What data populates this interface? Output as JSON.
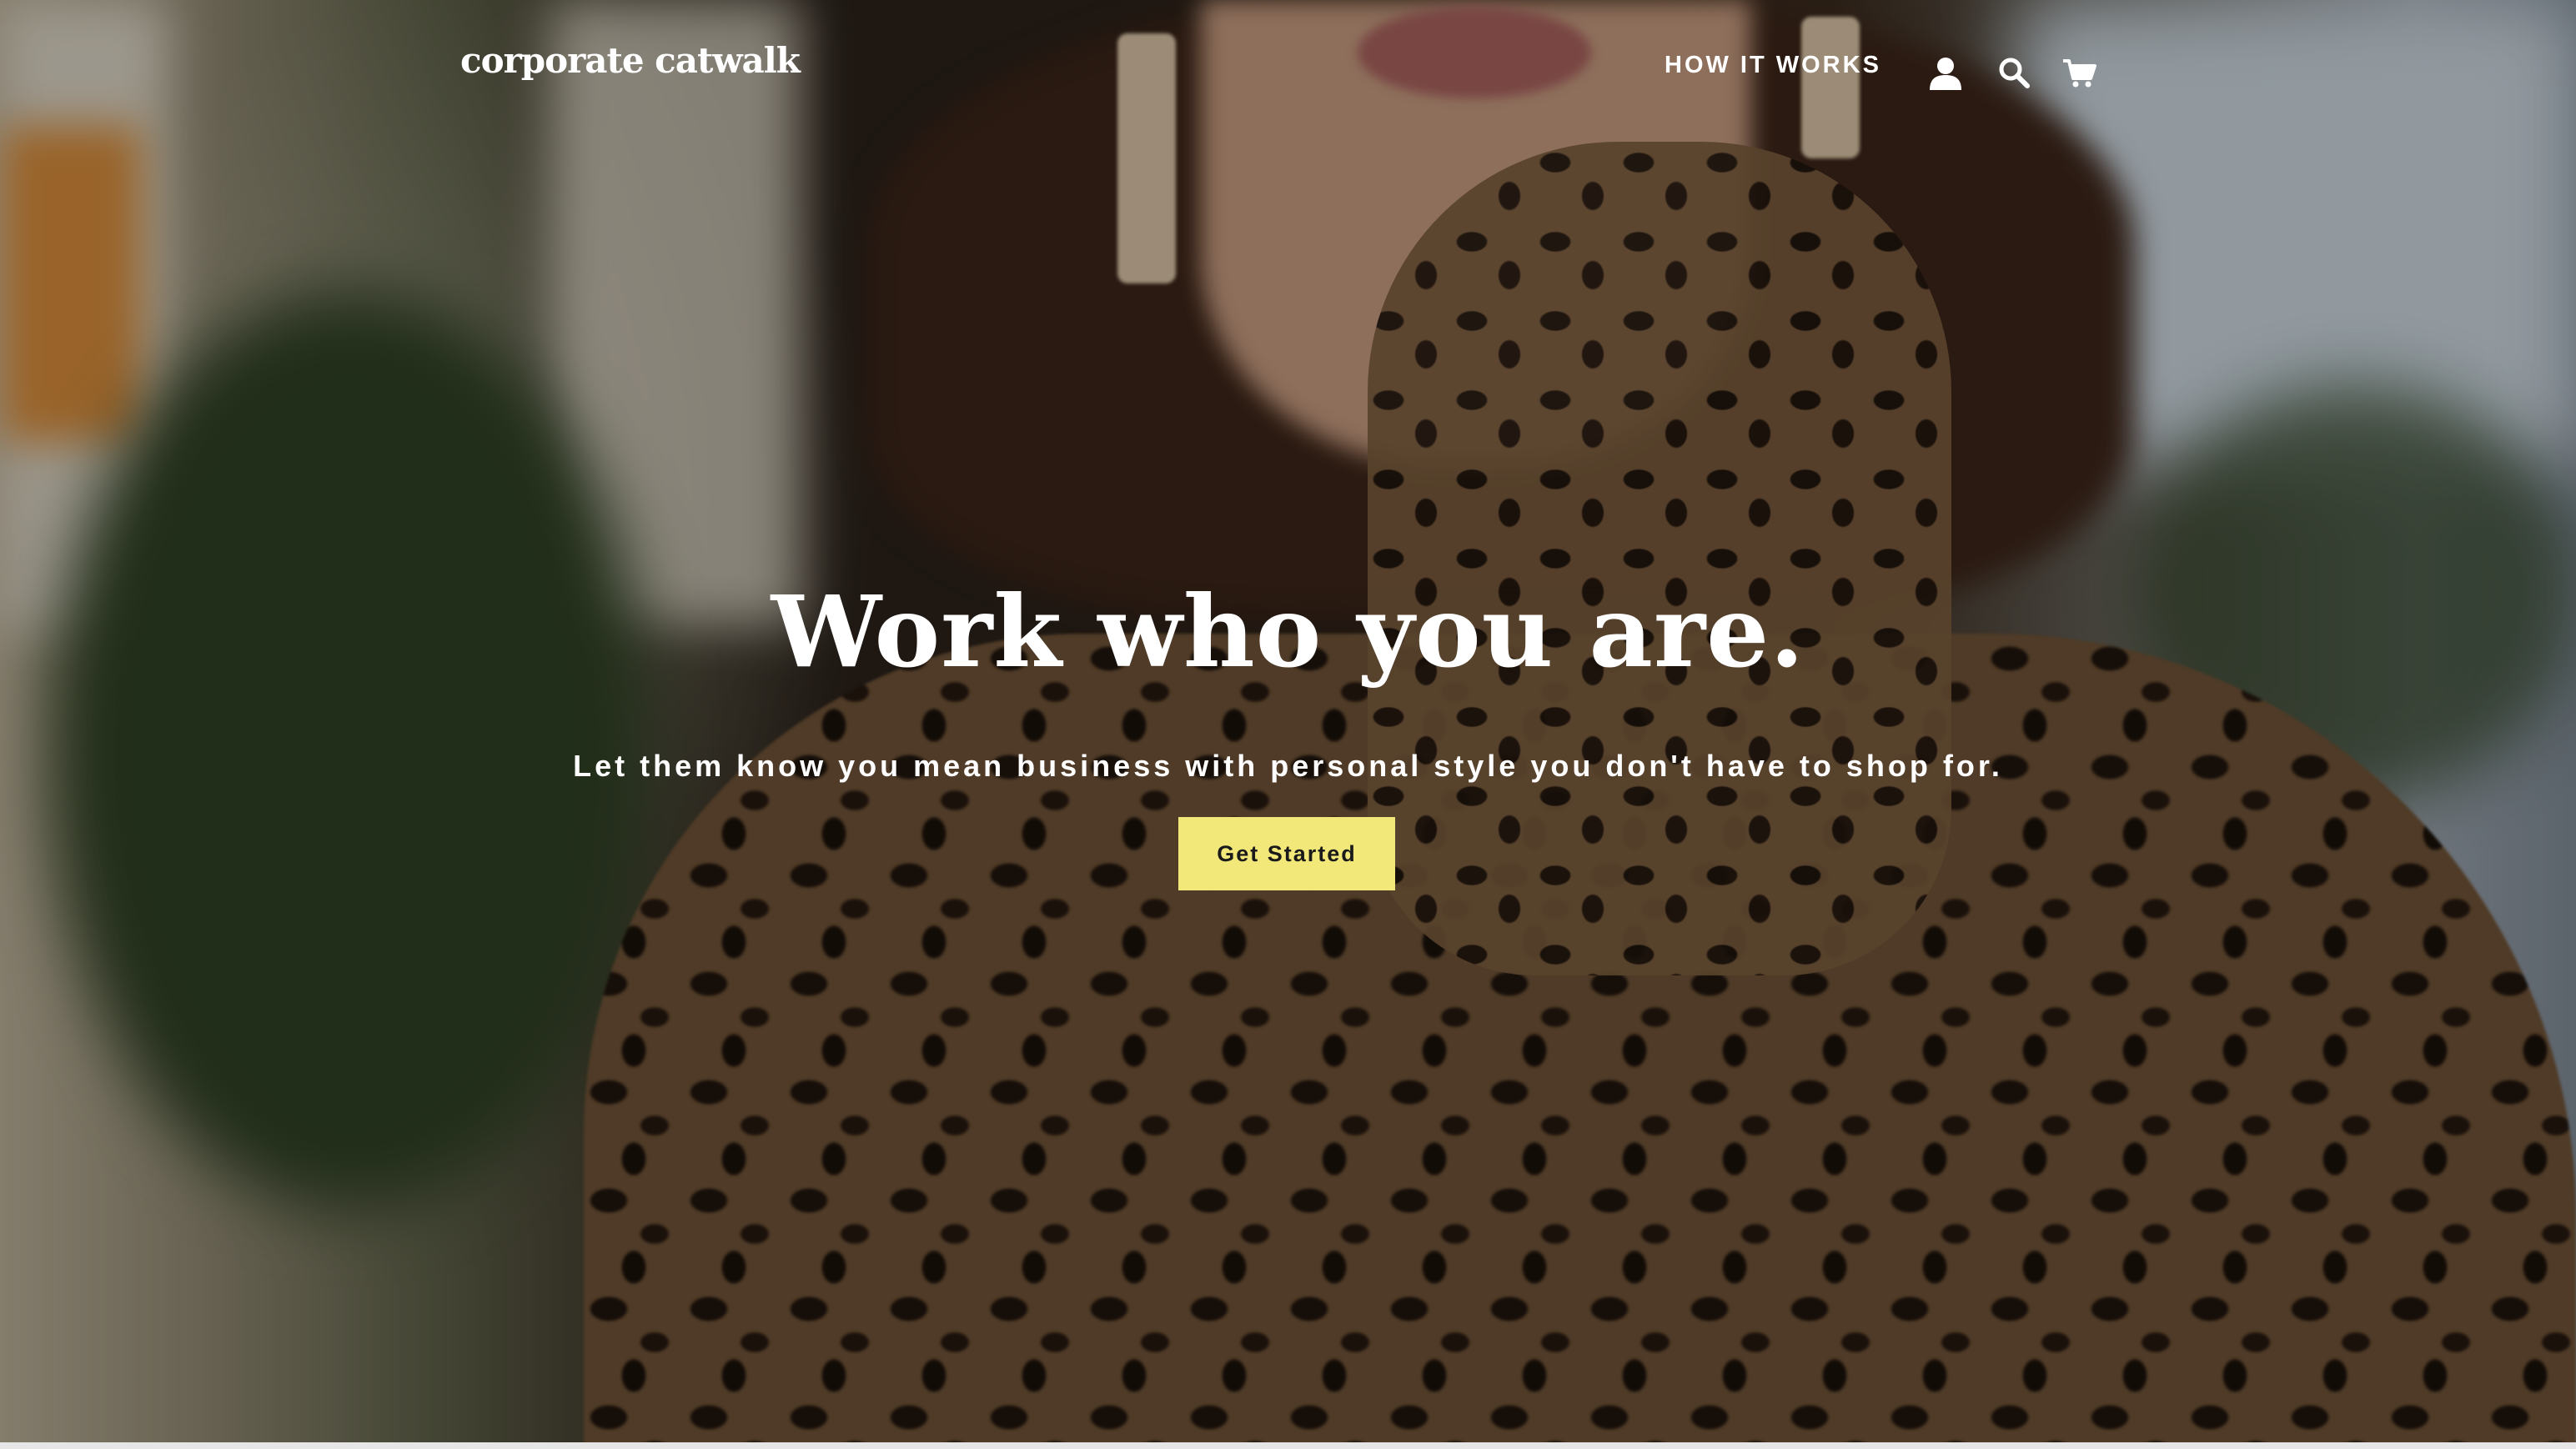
{
  "header": {
    "logo": "corporate catwalk",
    "nav": {
      "how_it_works": "HOW IT WORKS"
    },
    "icons": [
      "account-icon",
      "search-icon",
      "cart-icon"
    ]
  },
  "hero": {
    "headline": "Work who you are.",
    "subheadline": "Let them know you mean business with personal style you don't have to shop for.",
    "cta_label": "Get Started"
  },
  "colors": {
    "cta_background": "#f2e879",
    "text": "#ffffff"
  }
}
